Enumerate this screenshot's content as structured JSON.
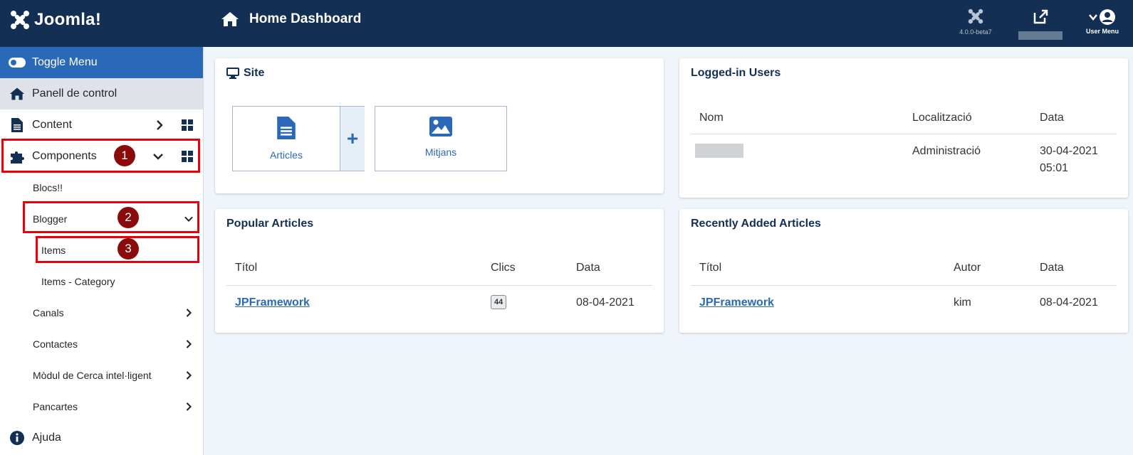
{
  "header": {
    "logo_text": "Joomla!",
    "title": "Home Dashboard",
    "version": "4.0.0-beta7",
    "user_menu_label": "User Menu"
  },
  "sidebar": {
    "toggle_menu": "Toggle Menu",
    "dashboard": "Panell de control",
    "content": "Content",
    "components": "Components",
    "items": [
      "Blocs!!",
      "Blogger",
      "Items",
      "Items - Category",
      "Canals",
      "Contactes",
      "Mòdul de Cerca intel·ligent",
      "Pancartes"
    ],
    "help": "Ajuda"
  },
  "annotations": [
    "1",
    "2",
    "3"
  ],
  "site_card": {
    "title": "Site",
    "quick_links": [
      "Articles",
      "Mitjans"
    ]
  },
  "logged_users": {
    "title": "Logged-in Users",
    "headers": [
      "Nom",
      "Localització",
      "Data"
    ],
    "row": {
      "location": "Administració",
      "date_line1": "30-04-2021",
      "date_line2": "05:01"
    }
  },
  "popular": {
    "title": "Popular Articles",
    "headers": [
      "Títol",
      "Clics",
      "Data"
    ],
    "row": {
      "title": "JPFramework",
      "clicks": "44",
      "date": "08-04-2021"
    }
  },
  "recent": {
    "title": "Recently Added Articles",
    "headers": [
      "Títol",
      "Autor",
      "Data"
    ],
    "row": {
      "title": "JPFramework",
      "author": "kim",
      "date": "08-04-2021"
    }
  },
  "colors": {
    "header_bg": "#132f53",
    "accent": "#2a69b8",
    "annotation_box": "#e8000b",
    "annotation_badge": "#8b0a0a"
  }
}
